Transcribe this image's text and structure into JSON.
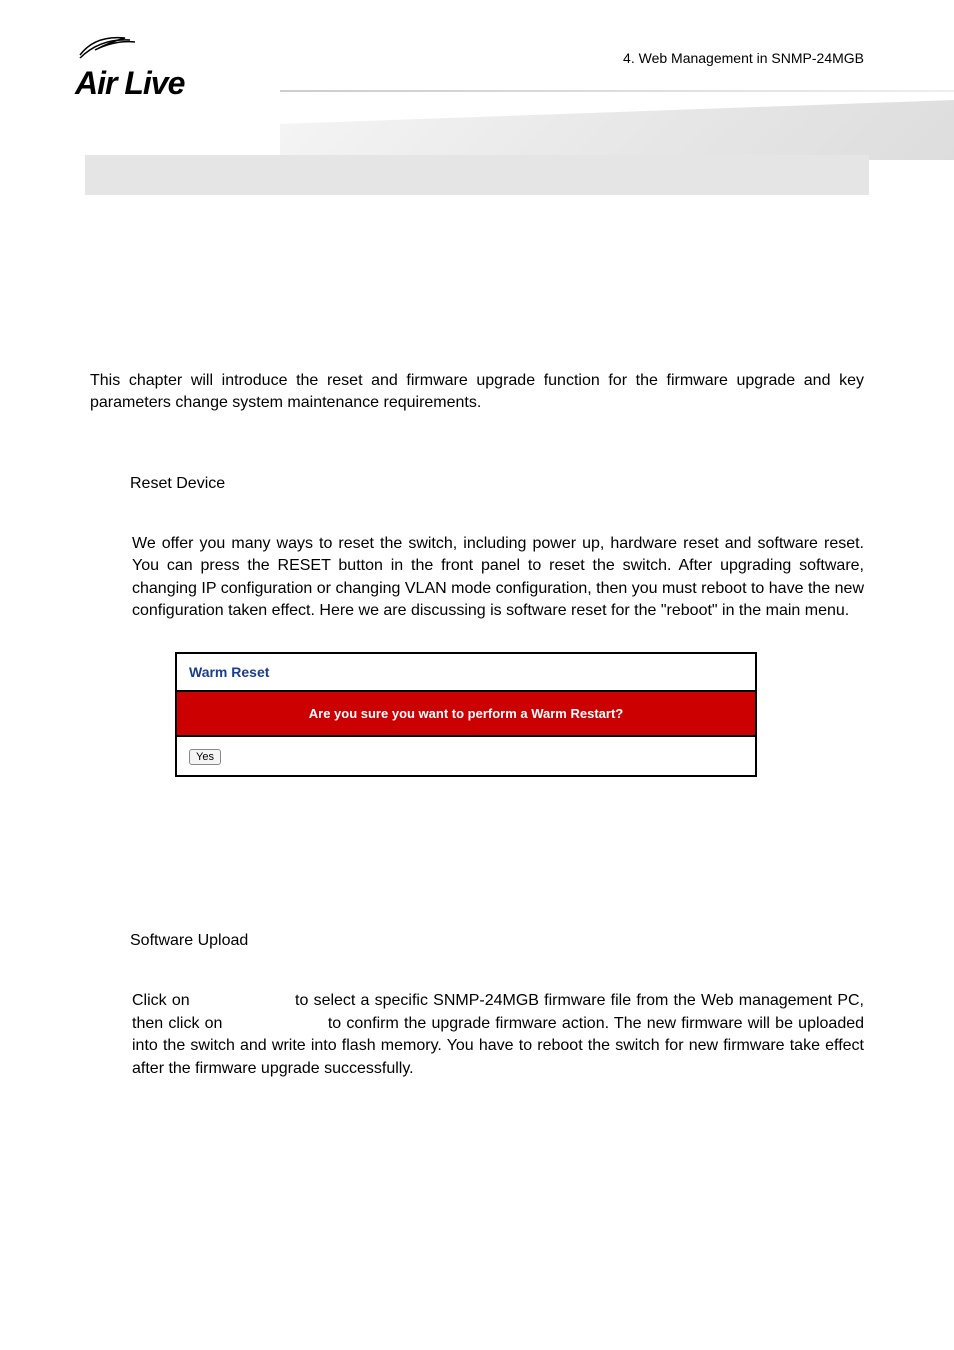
{
  "header": {
    "chapter_line": "4.  Web  Management  in  SNMP-24MGB",
    "logo_text": "Air Live"
  },
  "intro": "This  chapter  will  introduce  the  reset  and  firmware  upgrade  function  for  the  firmware upgrade and key parameters change system maintenance requirements.",
  "section1": {
    "heading": "Reset Device",
    "body": "We offer you many ways to reset the switch, including power up, hardware reset and software reset. You can press the RESET button in the front panel to reset the switch. After  upgrading  software,  changing  IP  configuration  or  changing  VLAN  mode configuration, then you must reboot to have the new configuration taken effect. Here we are discussing is software reset for the \"reboot\" in the main menu."
  },
  "figure": {
    "title": "Warm Reset",
    "warning": "Are you sure you want to perform a Warm Restart?",
    "button": "Yes"
  },
  "section2": {
    "heading": "Software Upload",
    "body_part1": "Click  on",
    "body_part2": "to  select  a  specific  SNMP-24MGB  firmware  file  from  the  Web management PC, then click on",
    "body_part3": "to confirm the upgrade firmware action. The new firmware will be uploaded into the switch and write into flash memory. You have to reboot the switch for new firmware take effect after the firmware upgrade successfully."
  }
}
